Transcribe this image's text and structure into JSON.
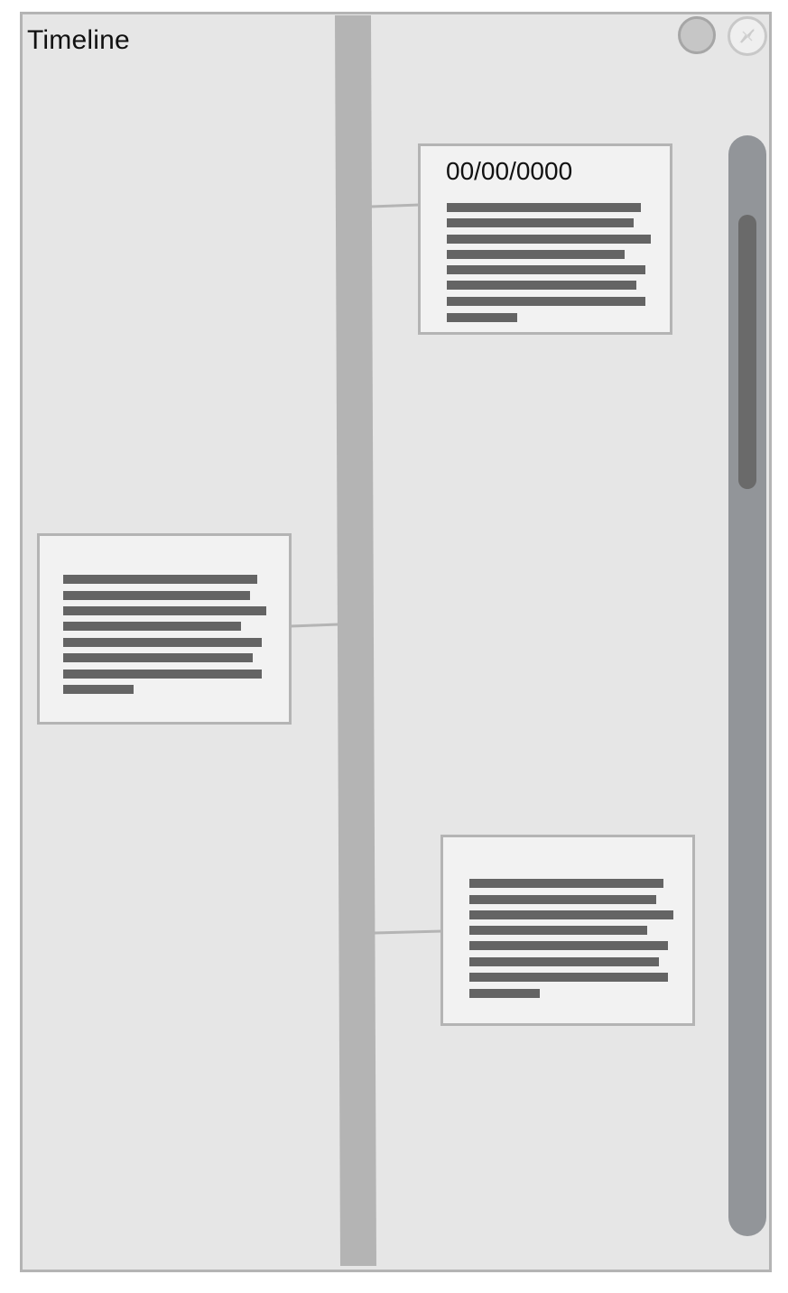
{
  "window": {
    "title": "Timeline"
  },
  "controls": {
    "left_button_icon": "circle-button",
    "right_button_icon": "compass-icon"
  },
  "events": [
    {
      "date": "00/00/0000",
      "side": "right",
      "text_placeholder_lines": 8
    },
    {
      "date": "",
      "side": "left",
      "text_placeholder_lines": 8
    },
    {
      "date": "",
      "side": "right",
      "text_placeholder_lines": 8
    }
  ],
  "colors": {
    "background": "#e6e6e6",
    "border": "#b4b4b4",
    "timeline_bar": "#b4b4b4",
    "card": "#f2f2f2",
    "text_placeholder": "#646464",
    "scroll_track": "#929599",
    "scroll_thumb": "#6a6a6a"
  }
}
